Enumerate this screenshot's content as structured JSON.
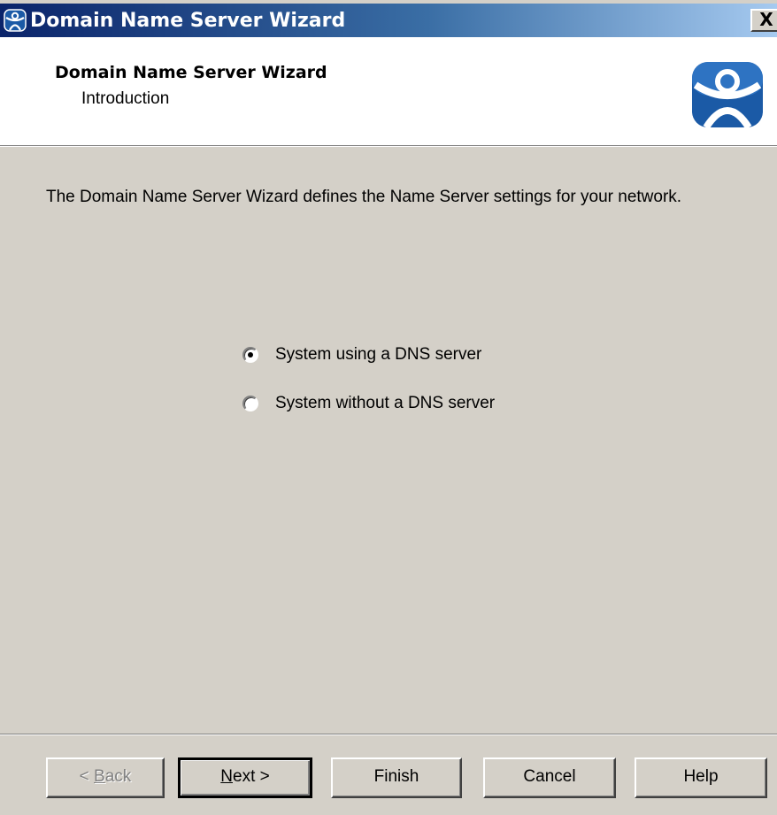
{
  "window": {
    "title": "Domain Name Server Wizard",
    "close_glyph": "X",
    "icon": "thinmanager-icon"
  },
  "header": {
    "title": "Domain Name Server Wizard",
    "subtitle": "Introduction",
    "logo": "thinmanager-logo"
  },
  "body": {
    "description": "The Domain Name Server Wizard defines the Name Server settings for your network."
  },
  "options": [
    {
      "label": "System using a DNS server",
      "selected": true
    },
    {
      "label": "System without a DNS server",
      "selected": false
    }
  ],
  "buttons": {
    "back": {
      "pre": "< ",
      "key": "B",
      "post": "ack",
      "enabled": false
    },
    "next": {
      "pre": "",
      "key": "N",
      "post": "ext >",
      "enabled": true
    },
    "finish": "Finish",
    "cancel": "Cancel",
    "help": "Help"
  },
  "colors": {
    "titlebar_start": "#0a246a",
    "titlebar_end": "#a6caf0",
    "logo_blue": "#1b5aa6",
    "dialog_face": "#d4d0c8"
  }
}
